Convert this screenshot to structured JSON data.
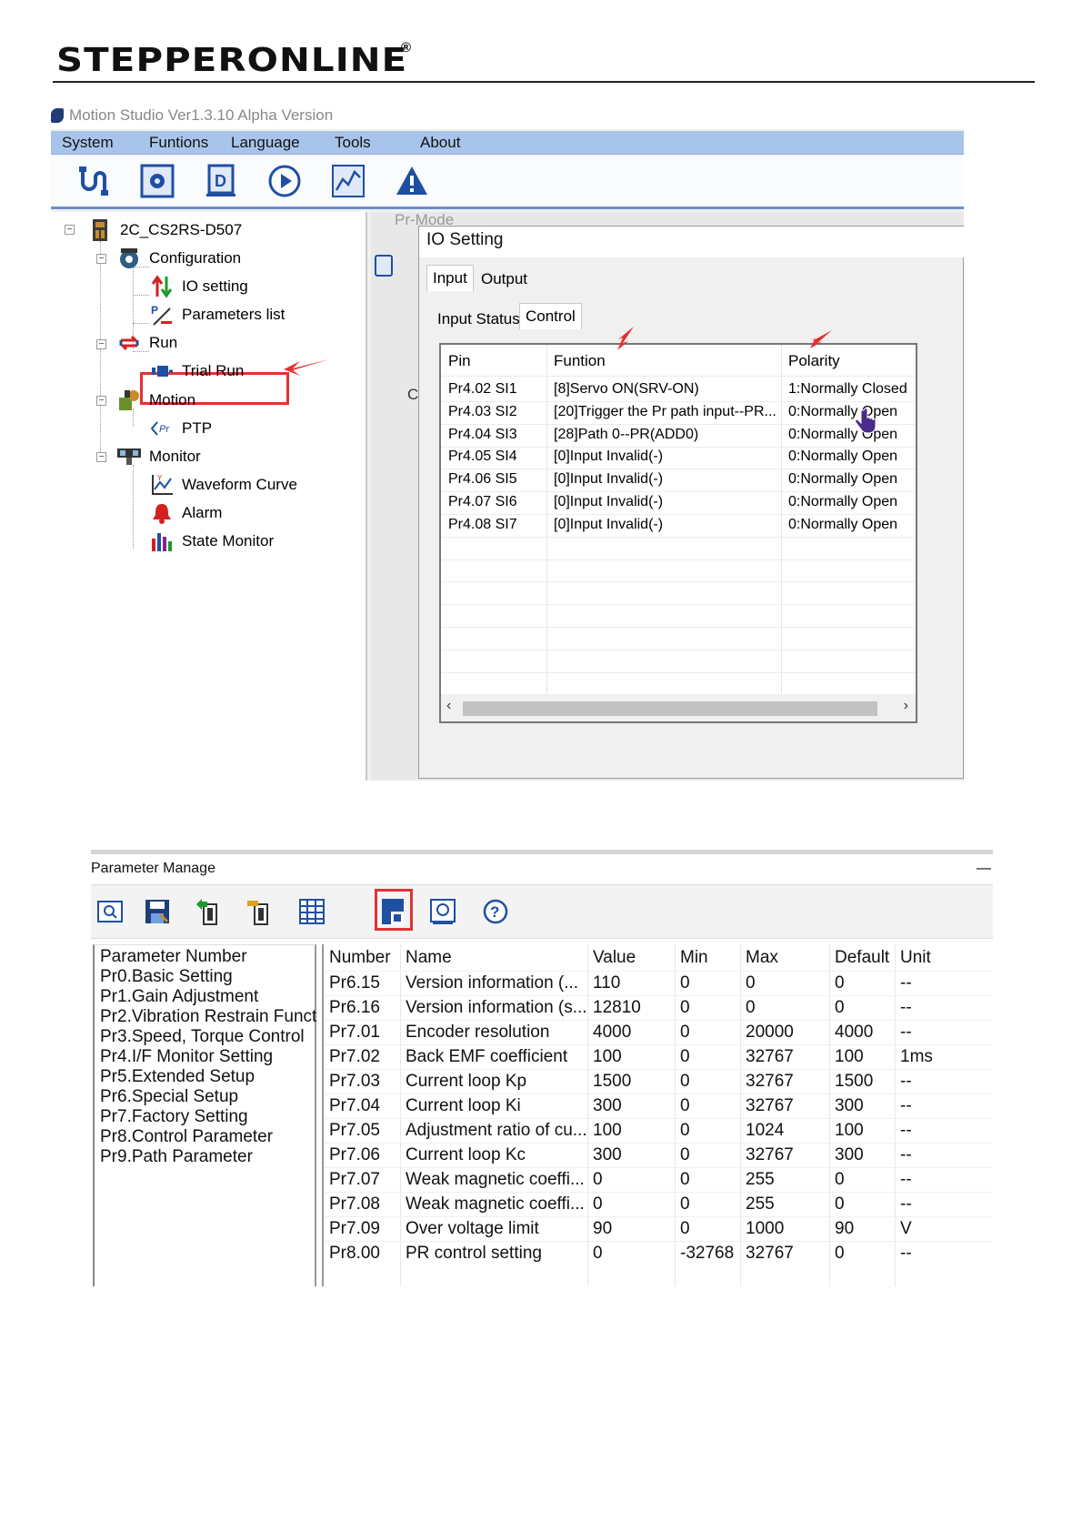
{
  "header": {
    "logo": "STEPPERONLINE",
    "reg_mark": "®"
  },
  "motion_studio": {
    "title": "Motion Studio  Ver1.3.10 Alpha Version",
    "menu": [
      "System",
      "Funtions",
      "Language",
      "Tools",
      "About"
    ],
    "toolbar_icons": [
      "connect-icon",
      "config-icon",
      "parameter-icon",
      "run-icon",
      "waveform-icon",
      "alarm-icon"
    ],
    "tree": {
      "root": "2C_CS2RS-D507",
      "configuration": "Configuration",
      "io_setting": "IO setting",
      "parameters_list": "Parameters list",
      "run": "Run",
      "trial_run": "Trial Run",
      "motion": "Motion",
      "ptp": "PTP",
      "monitor": "Monitor",
      "waveform_curve": "Waveform Curve",
      "alarm": "Alarm",
      "state_monitor": "State Monitor"
    },
    "background_window": "Pr-Mode",
    "dialog": {
      "title": "IO Setting",
      "tabs": [
        "Input",
        "Output"
      ],
      "subtabs": [
        "Input Status",
        "Control"
      ],
      "columns": [
        "Pin",
        "Funtion",
        "Polarity"
      ],
      "rows": [
        [
          "Pr4.02 SI1",
          "[8]Servo ON(SRV-ON)",
          "1:Normally Closed"
        ],
        [
          "Pr4.03 SI2",
          "[20]Trigger the Pr path input--PR...",
          "0:Normally Open"
        ],
        [
          "Pr4.04 SI3",
          "[28]Path 0--PR(ADD0)",
          "0:Normally Open"
        ],
        [
          "Pr4.05 SI4",
          "[0]Input Invalid(-)",
          "0:Normally Open"
        ],
        [
          "Pr4.06 SI5",
          "[0]Input Invalid(-)",
          "0:Normally Open"
        ],
        [
          "Pr4.07 SI6",
          "[0]Input Invalid(-)",
          "0:Normally Open"
        ],
        [
          "Pr4.08 SI7",
          "[0]Input Invalid(-)",
          "0:Normally Open"
        ]
      ]
    }
  },
  "parameter_manage": {
    "title": "Parameter Manage",
    "toolbar_icons": [
      "open-file-icon",
      "save-icon",
      "upload-icon",
      "download-icon",
      "table-icon",
      "save-to-device-icon",
      "restore-icon",
      "help-icon"
    ],
    "groups": [
      "Parameter Number",
      "Pr0.Basic Setting",
      "Pr1.Gain Adjustment",
      "Pr2.Vibration Restrain Funct",
      "Pr3.Speed, Torque Control",
      "Pr4.I/F Monitor Setting",
      "Pr5.Extended Setup",
      "Pr6.Special Setup",
      "Pr7.Factory Setting",
      "Pr8.Control Parameter",
      "Pr9.Path Parameter"
    ],
    "columns": [
      "Number",
      "Name",
      "Value",
      "Min",
      "Max",
      "Default",
      "Unit"
    ],
    "rows": [
      [
        "Pr6.15",
        "Version information (...",
        "110",
        "0",
        "0",
        "0",
        "--"
      ],
      [
        "Pr6.16",
        "Version information (s...",
        "12810",
        "0",
        "0",
        "0",
        "--"
      ],
      [
        "Pr7.01",
        "Encoder resolution",
        "4000",
        "0",
        "20000",
        "4000",
        "--"
      ],
      [
        "Pr7.02",
        "Back EMF coefficient",
        "100",
        "0",
        "32767",
        "100",
        "1ms"
      ],
      [
        "Pr7.03",
        "Current loop Kp",
        "1500",
        "0",
        "32767",
        "1500",
        "--"
      ],
      [
        "Pr7.04",
        "Current loop Ki",
        "300",
        "0",
        "32767",
        "300",
        "--"
      ],
      [
        "Pr7.05",
        "Adjustment ratio of cu...",
        "100",
        "0",
        "1024",
        "100",
        "--"
      ],
      [
        "Pr7.06",
        "Current loop Kc",
        "300",
        "0",
        "32767",
        "300",
        "--"
      ],
      [
        "Pr7.07",
        "Weak magnetic coeffi...",
        "0",
        "0",
        "255",
        "0",
        "--"
      ],
      [
        "Pr7.08",
        "Weak magnetic coeffi...",
        "0",
        "0",
        "255",
        "0",
        "--"
      ],
      [
        "Pr7.09",
        "Over voltage limit",
        "90",
        "0",
        "1000",
        "90",
        "V"
      ],
      [
        "Pr8.00",
        "PR control setting",
        "0",
        "-32768",
        "32767",
        "0",
        "--"
      ]
    ]
  },
  "colors": {
    "accent_red": "#e13232",
    "menubar": "#a9c4ea",
    "toolbar_border": "#6d8fc9"
  }
}
